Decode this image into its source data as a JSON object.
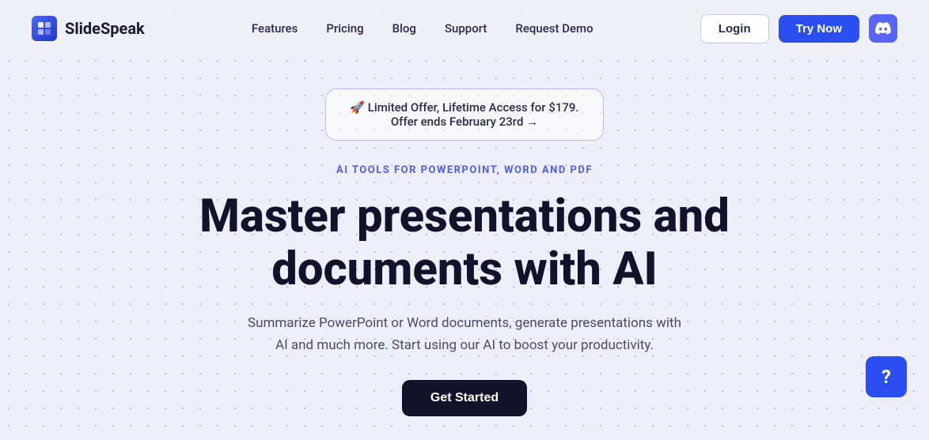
{
  "brand": {
    "logo_text": "SlideSpeak",
    "logo_icon": "🟦"
  },
  "navbar": {
    "links": [
      {
        "label": "Features",
        "id": "features"
      },
      {
        "label": "Pricing",
        "id": "pricing"
      },
      {
        "label": "Blog",
        "id": "blog"
      },
      {
        "label": "Support",
        "id": "support"
      },
      {
        "label": "Request Demo",
        "id": "request-demo"
      }
    ],
    "login_label": "Login",
    "try_now_label": "Try Now"
  },
  "offer_banner": {
    "line1": "🚀 Limited Offer, Lifetime Access for $179.",
    "line2": "Offer ends February 23rd →"
  },
  "hero": {
    "subtitle": "AI TOOLS FOR POWERPOINT, WORD AND PDF",
    "heading_line1": "Master presentations and",
    "heading_line2": "documents with AI",
    "description": "Summarize PowerPoint or Word documents, generate presentations with AI and much more. Start using our AI to boost your productivity.",
    "cta_label": "Get Started"
  },
  "help_button": {
    "label": "?"
  },
  "colors": {
    "accent_blue": "#2a4ef0",
    "dark": "#12122a",
    "purple_light": "#5060e0"
  }
}
